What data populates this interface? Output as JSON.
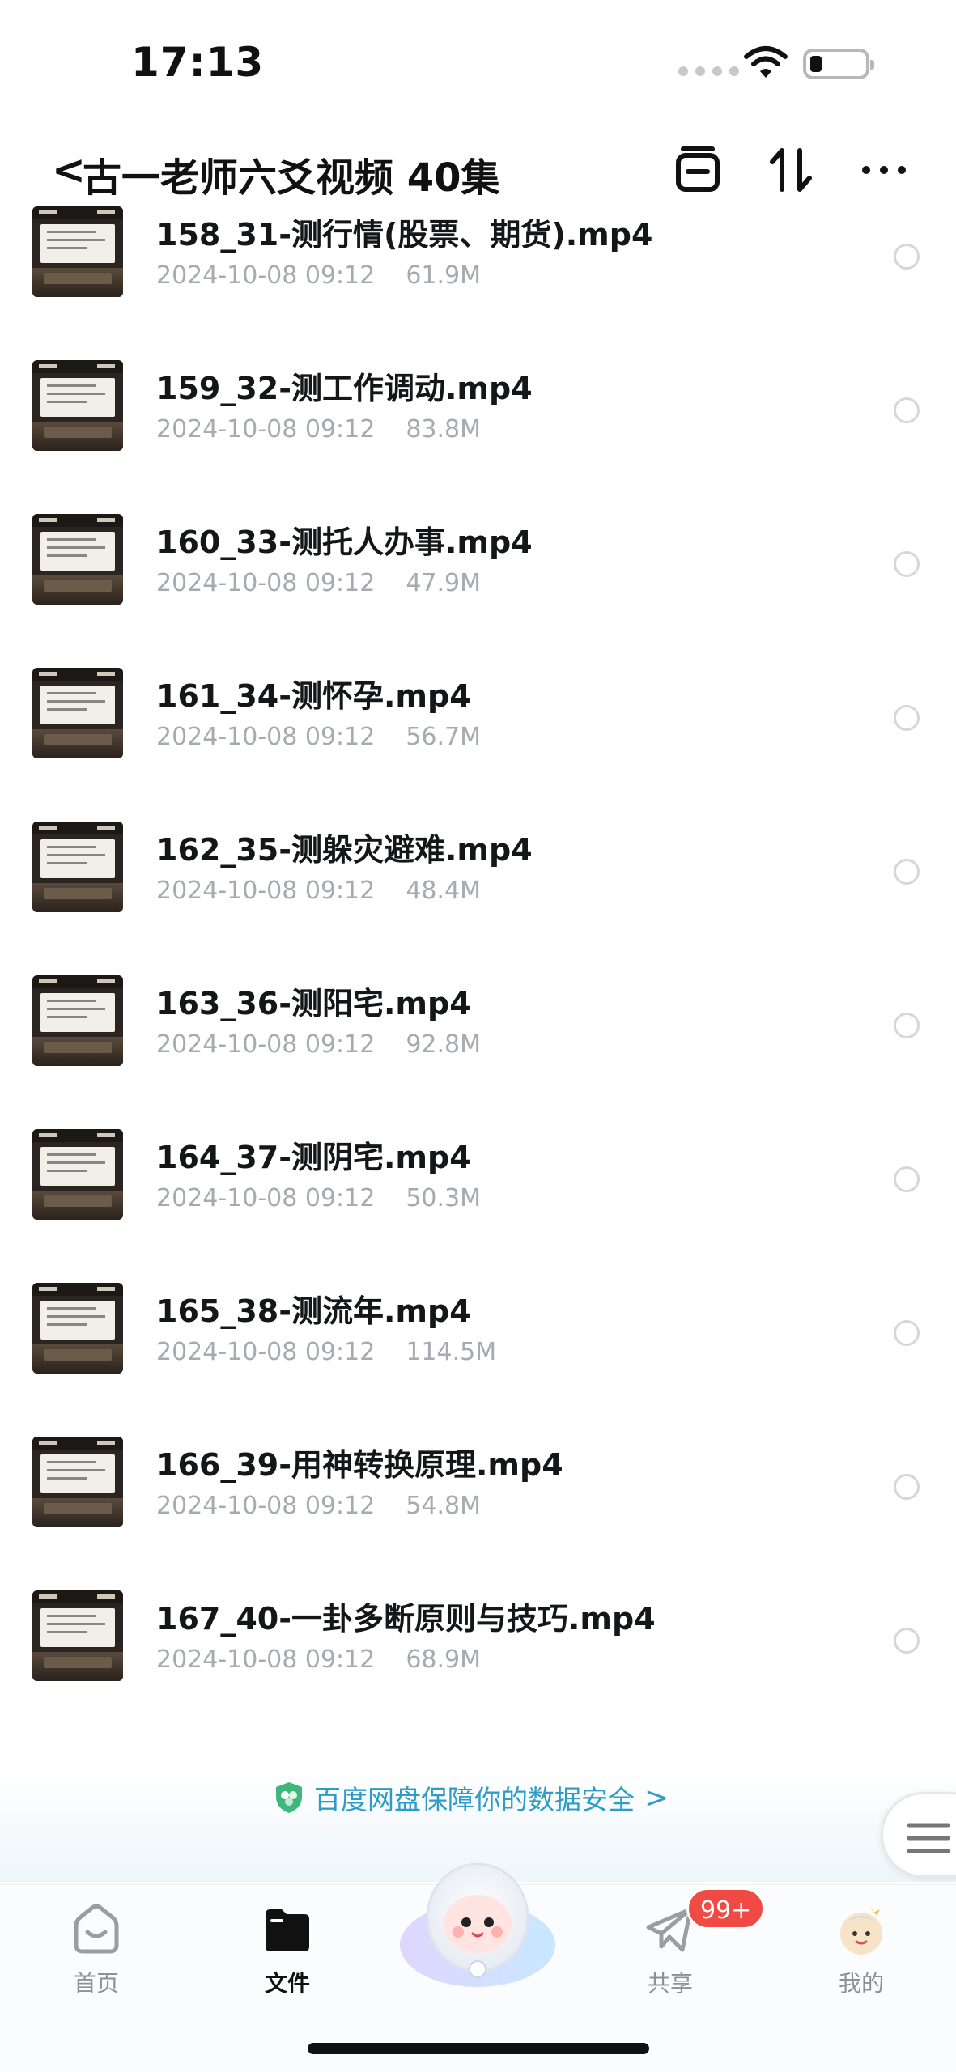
{
  "status_bar": {
    "time": "17:13"
  },
  "header": {
    "back_symbol": "<",
    "title": "古一老师六爻视频 40集"
  },
  "files": [
    {
      "name": "158_31-测行情(股票、期货).mp4",
      "date": "2024-10-08 09:12",
      "size": "61.9M"
    },
    {
      "name": "159_32-测工作调动.mp4",
      "date": "2024-10-08 09:12",
      "size": "83.8M"
    },
    {
      "name": "160_33-测托人办事.mp4",
      "date": "2024-10-08 09:12",
      "size": "47.9M"
    },
    {
      "name": "161_34-测怀孕.mp4",
      "date": "2024-10-08 09:12",
      "size": "56.7M"
    },
    {
      "name": "162_35-测躲灾避难.mp4",
      "date": "2024-10-08 09:12",
      "size": "48.4M"
    },
    {
      "name": "163_36-测阳宅.mp4",
      "date": "2024-10-08 09:12",
      "size": "92.8M"
    },
    {
      "name": "164_37-测阴宅.mp4",
      "date": "2024-10-08 09:12",
      "size": "50.3M"
    },
    {
      "name": "165_38-测流年.mp4",
      "date": "2024-10-08 09:12",
      "size": "114.5M"
    },
    {
      "name": "166_39-用神转换原理.mp4",
      "date": "2024-10-08 09:12",
      "size": "54.8M"
    },
    {
      "name": "167_40-一卦多断原则与技巧.mp4",
      "date": "2024-10-08 09:12",
      "size": "68.9M"
    }
  ],
  "security_banner": {
    "text": "百度网盘保障你的数据安全",
    "arrow": ">"
  },
  "tab_bar": {
    "home": "首页",
    "files": "文件",
    "share": "共享",
    "mine": "我的",
    "share_badge": "99+"
  },
  "colors": {
    "accent": "#2e9cc6",
    "badge": "#f04a45"
  }
}
